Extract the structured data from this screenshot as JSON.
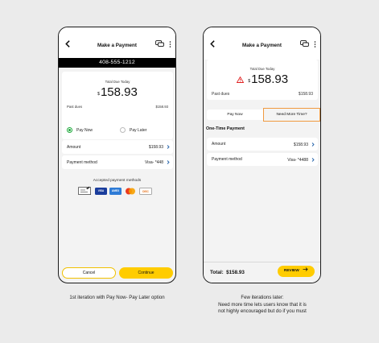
{
  "screen1": {
    "title": "Make a Payment",
    "phone_number": "408-555-1212",
    "total_label": "Total Due Today",
    "currency": "$",
    "amount": "158.93",
    "past_dues_label": "Past dues",
    "past_dues_value": "$158.93",
    "option_pay_now": "Pay Now",
    "option_pay_later": "Pay Later",
    "amount_label": "Amount",
    "amount_value": "$158.93",
    "method_label": "Payment method",
    "method_value": "Visa- *448",
    "accepted_label": "Accepted payment methods",
    "payment_methods": [
      "check-icon",
      "visa",
      "amex",
      "mastercard",
      "discover"
    ],
    "cancel_label": "Cancel",
    "continue_label": "Continue"
  },
  "screen2": {
    "title": "Make a Payment",
    "total_label": "Total Due Today",
    "currency": "$",
    "amount": "158.93",
    "past_dues_label": "Past dues",
    "past_dues_value": "$158.93",
    "tab_pay_now": "Pay Now",
    "tab_need_time": "Need More Time?",
    "section_title": "One-Time Payment",
    "amount_label": "Amount",
    "amount_value": "$158.93",
    "method_label": "Payment method",
    "method_value": "Visa- *4488",
    "total_footer_label": "Total:",
    "total_footer_value": "$158.93",
    "review_label": "REVIEW"
  },
  "captions": {
    "first": "1st iteration with Pay Now- Pay Later option",
    "second_line1": "Few iterations later:",
    "second_line2": "Need more time lets users know that it is",
    "second_line3": "not highly encouraged but do if you must"
  },
  "colors": {
    "accent_yellow": "#ffcc00",
    "radio_green": "#1faa3c",
    "highlight_orange": "#f09a40",
    "warning_red": "#e02020"
  }
}
